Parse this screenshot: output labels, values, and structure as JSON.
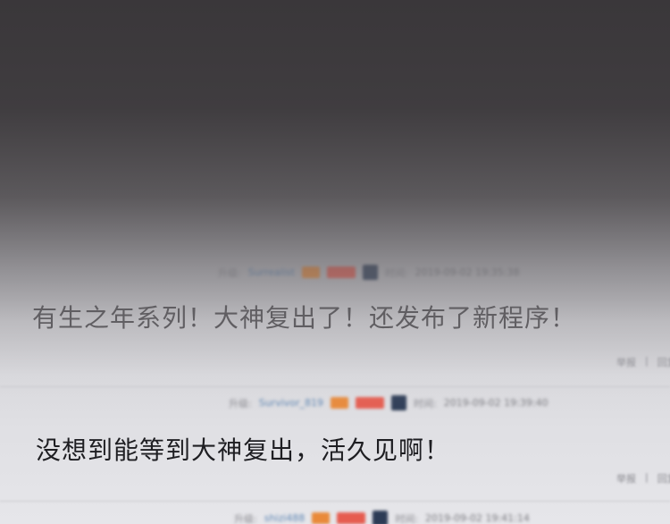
{
  "posts": [
    {
      "meta": {
        "label": "升级:",
        "username": "Surrealist",
        "badge1": "",
        "badge2": "",
        "time_label": "时间:",
        "time": "2019-09-02 19:35:38"
      },
      "text": "有生之年系列！大神复出了！还发布了新程序！",
      "footer": {
        "left": "举报",
        "sep": "|",
        "right": "回复"
      }
    },
    {
      "meta": {
        "label": "升级:",
        "username": "Survivor_819",
        "badge1": "",
        "badge2": "",
        "time_label": "时间:",
        "time": "2019-09-02 19:39:40"
      },
      "text": "没想到能等到大神复出，活久见啊！",
      "footer": {
        "left": "举报",
        "sep": "|",
        "right": "回复"
      }
    },
    {
      "meta": {
        "label": "升级:",
        "username": "shizi488",
        "badge1": "",
        "badge2": "",
        "time_label": "时间:",
        "time": "2019-09-02 19:41:14"
      }
    }
  ],
  "colors": {
    "overlay_top": "#3a373a",
    "page_bg": "#e6e6ea",
    "username": "#5e86b3",
    "badge_orange": "#e98a3a",
    "badge_red": "#e65c4f",
    "text_dark": "#1e1e22",
    "text_dim": "#4a484c"
  }
}
